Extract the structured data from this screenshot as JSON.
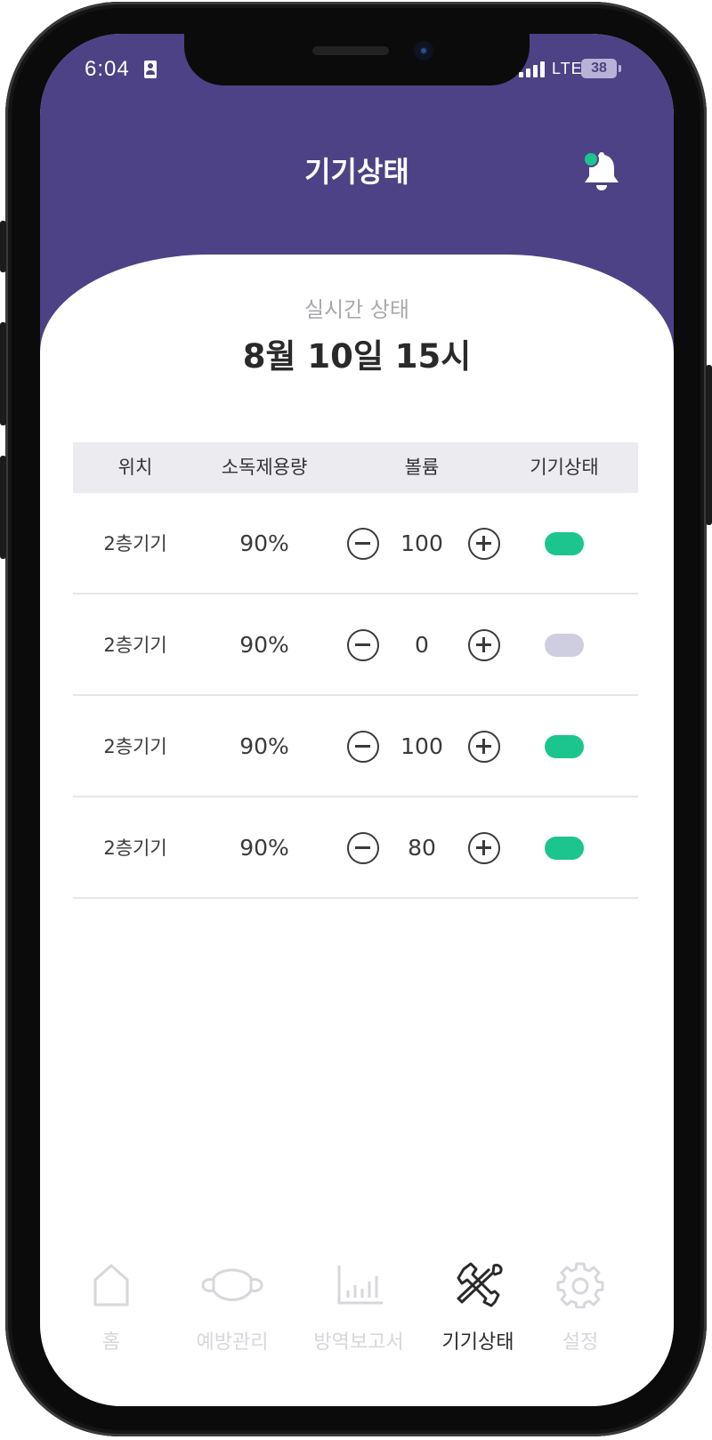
{
  "status_bar": {
    "time": "6:04",
    "network": "LTE",
    "battery": "38"
  },
  "header": {
    "title": "기기상태",
    "notification_dot_color": "#1cc48e",
    "background_color": "#4c4285"
  },
  "summary": {
    "subtitle": "실시간 상태",
    "datetime": "8월 10일 15시"
  },
  "table": {
    "columns": [
      "위치",
      "소독제용량",
      "볼륨",
      "기기상태"
    ],
    "rows": [
      {
        "location": "2층기기",
        "capacity": "90%",
        "volume": "100",
        "device_on": true
      },
      {
        "location": "2층기기",
        "capacity": "90%",
        "volume": "0",
        "device_on": false
      },
      {
        "location": "2층기기",
        "capacity": "90%",
        "volume": "100",
        "device_on": true
      },
      {
        "location": "2층기기",
        "capacity": "90%",
        "volume": "80",
        "device_on": true
      }
    ],
    "status_on_color": "#1cc48e",
    "status_off_color": "#cfcde0"
  },
  "bottom_nav": {
    "items": [
      {
        "label": "홈",
        "icon": "home-icon",
        "active": false
      },
      {
        "label": "예방관리",
        "icon": "mask-icon",
        "active": false
      },
      {
        "label": "방역보고서",
        "icon": "bar-chart-icon",
        "active": false
      },
      {
        "label": "기기상태",
        "icon": "tools-icon",
        "active": true
      },
      {
        "label": "설정",
        "icon": "gear-icon",
        "active": false
      }
    ]
  }
}
